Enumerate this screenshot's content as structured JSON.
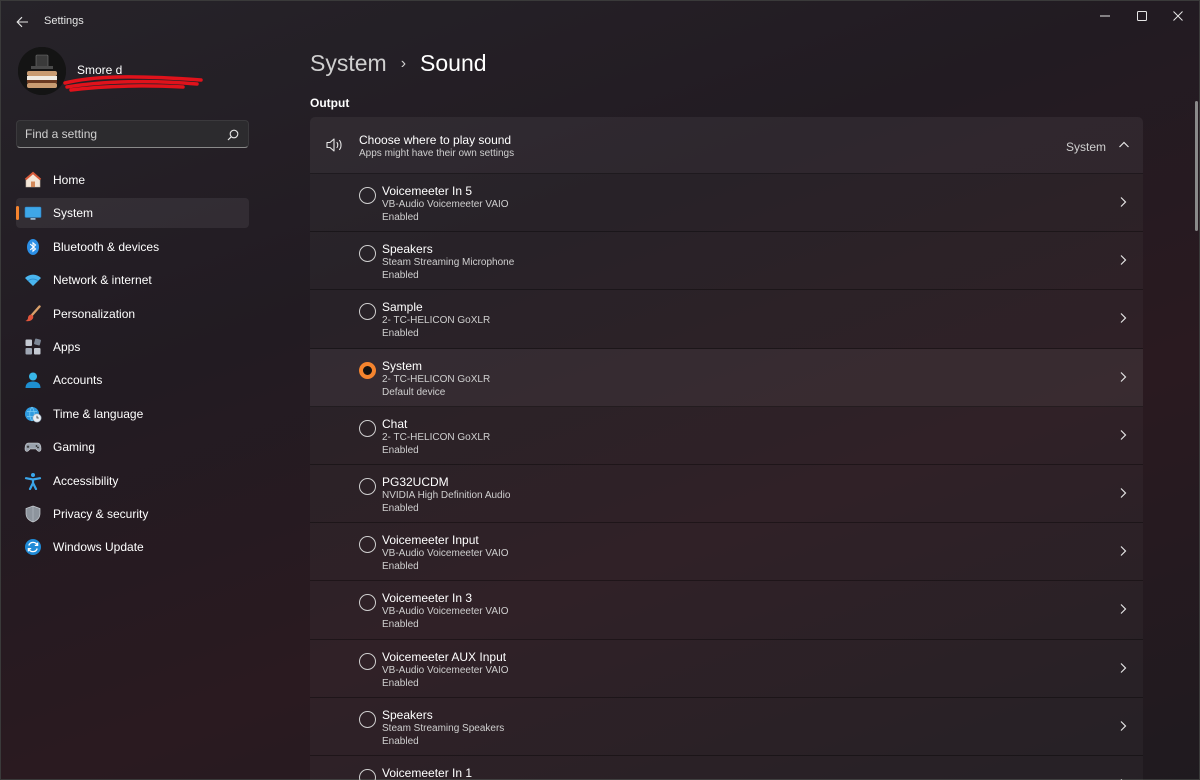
{
  "window": {
    "title": "Settings"
  },
  "profile": {
    "name": "Smore d"
  },
  "search": {
    "placeholder": "Find a setting"
  },
  "nav": [
    {
      "label": "Home",
      "icon": "home-icon",
      "active": false
    },
    {
      "label": "System",
      "icon": "monitor-icon",
      "active": true
    },
    {
      "label": "Bluetooth & devices",
      "icon": "bluetooth-icon",
      "active": false
    },
    {
      "label": "Network & internet",
      "icon": "wifi-icon",
      "active": false
    },
    {
      "label": "Personalization",
      "icon": "brush-icon",
      "active": false
    },
    {
      "label": "Apps",
      "icon": "apps-icon",
      "active": false
    },
    {
      "label": "Accounts",
      "icon": "person-icon",
      "active": false
    },
    {
      "label": "Time & language",
      "icon": "globe-clock-icon",
      "active": false
    },
    {
      "label": "Gaming",
      "icon": "gamepad-icon",
      "active": false
    },
    {
      "label": "Accessibility",
      "icon": "accessibility-icon",
      "active": false
    },
    {
      "label": "Privacy & security",
      "icon": "shield-icon",
      "active": false
    },
    {
      "label": "Windows Update",
      "icon": "update-icon",
      "active": false
    }
  ],
  "breadcrumb": {
    "parent": "System",
    "separator": "›",
    "current": "Sound"
  },
  "output": {
    "section_title": "Output",
    "header": {
      "title": "Choose where to play sound",
      "subtitle": "Apps might have their own settings",
      "value": "System"
    },
    "devices": [
      {
        "name": "Voicemeeter In 5",
        "sub": "VB-Audio Voicemeeter VAIO",
        "status": "Enabled",
        "selected": false
      },
      {
        "name": "Speakers",
        "sub": "Steam Streaming Microphone",
        "status": "Enabled",
        "selected": false
      },
      {
        "name": "Sample",
        "sub": "2- TC-HELICON GoXLR",
        "status": "Enabled",
        "selected": false
      },
      {
        "name": "System",
        "sub": "2- TC-HELICON GoXLR",
        "status": "Default device",
        "selected": true
      },
      {
        "name": "Chat",
        "sub": "2- TC-HELICON GoXLR",
        "status": "Enabled",
        "selected": false
      },
      {
        "name": "PG32UCDM",
        "sub": "NVIDIA High Definition Audio",
        "status": "Enabled",
        "selected": false
      },
      {
        "name": "Voicemeeter Input",
        "sub": "VB-Audio Voicemeeter VAIO",
        "status": "Enabled",
        "selected": false
      },
      {
        "name": "Voicemeeter In 3",
        "sub": "VB-Audio Voicemeeter VAIO",
        "status": "Enabled",
        "selected": false
      },
      {
        "name": "Voicemeeter AUX Input",
        "sub": "VB-Audio Voicemeeter VAIO",
        "status": "Enabled",
        "selected": false
      },
      {
        "name": "Speakers",
        "sub": "Steam Streaming Speakers",
        "status": "Enabled",
        "selected": false
      },
      {
        "name": "Voicemeeter In 1",
        "sub": "",
        "status": "",
        "selected": false
      }
    ]
  },
  "colors": {
    "accent": "#f5842e",
    "background": "#221b22",
    "card": "#2b2730",
    "redaction": "#e0121b"
  }
}
